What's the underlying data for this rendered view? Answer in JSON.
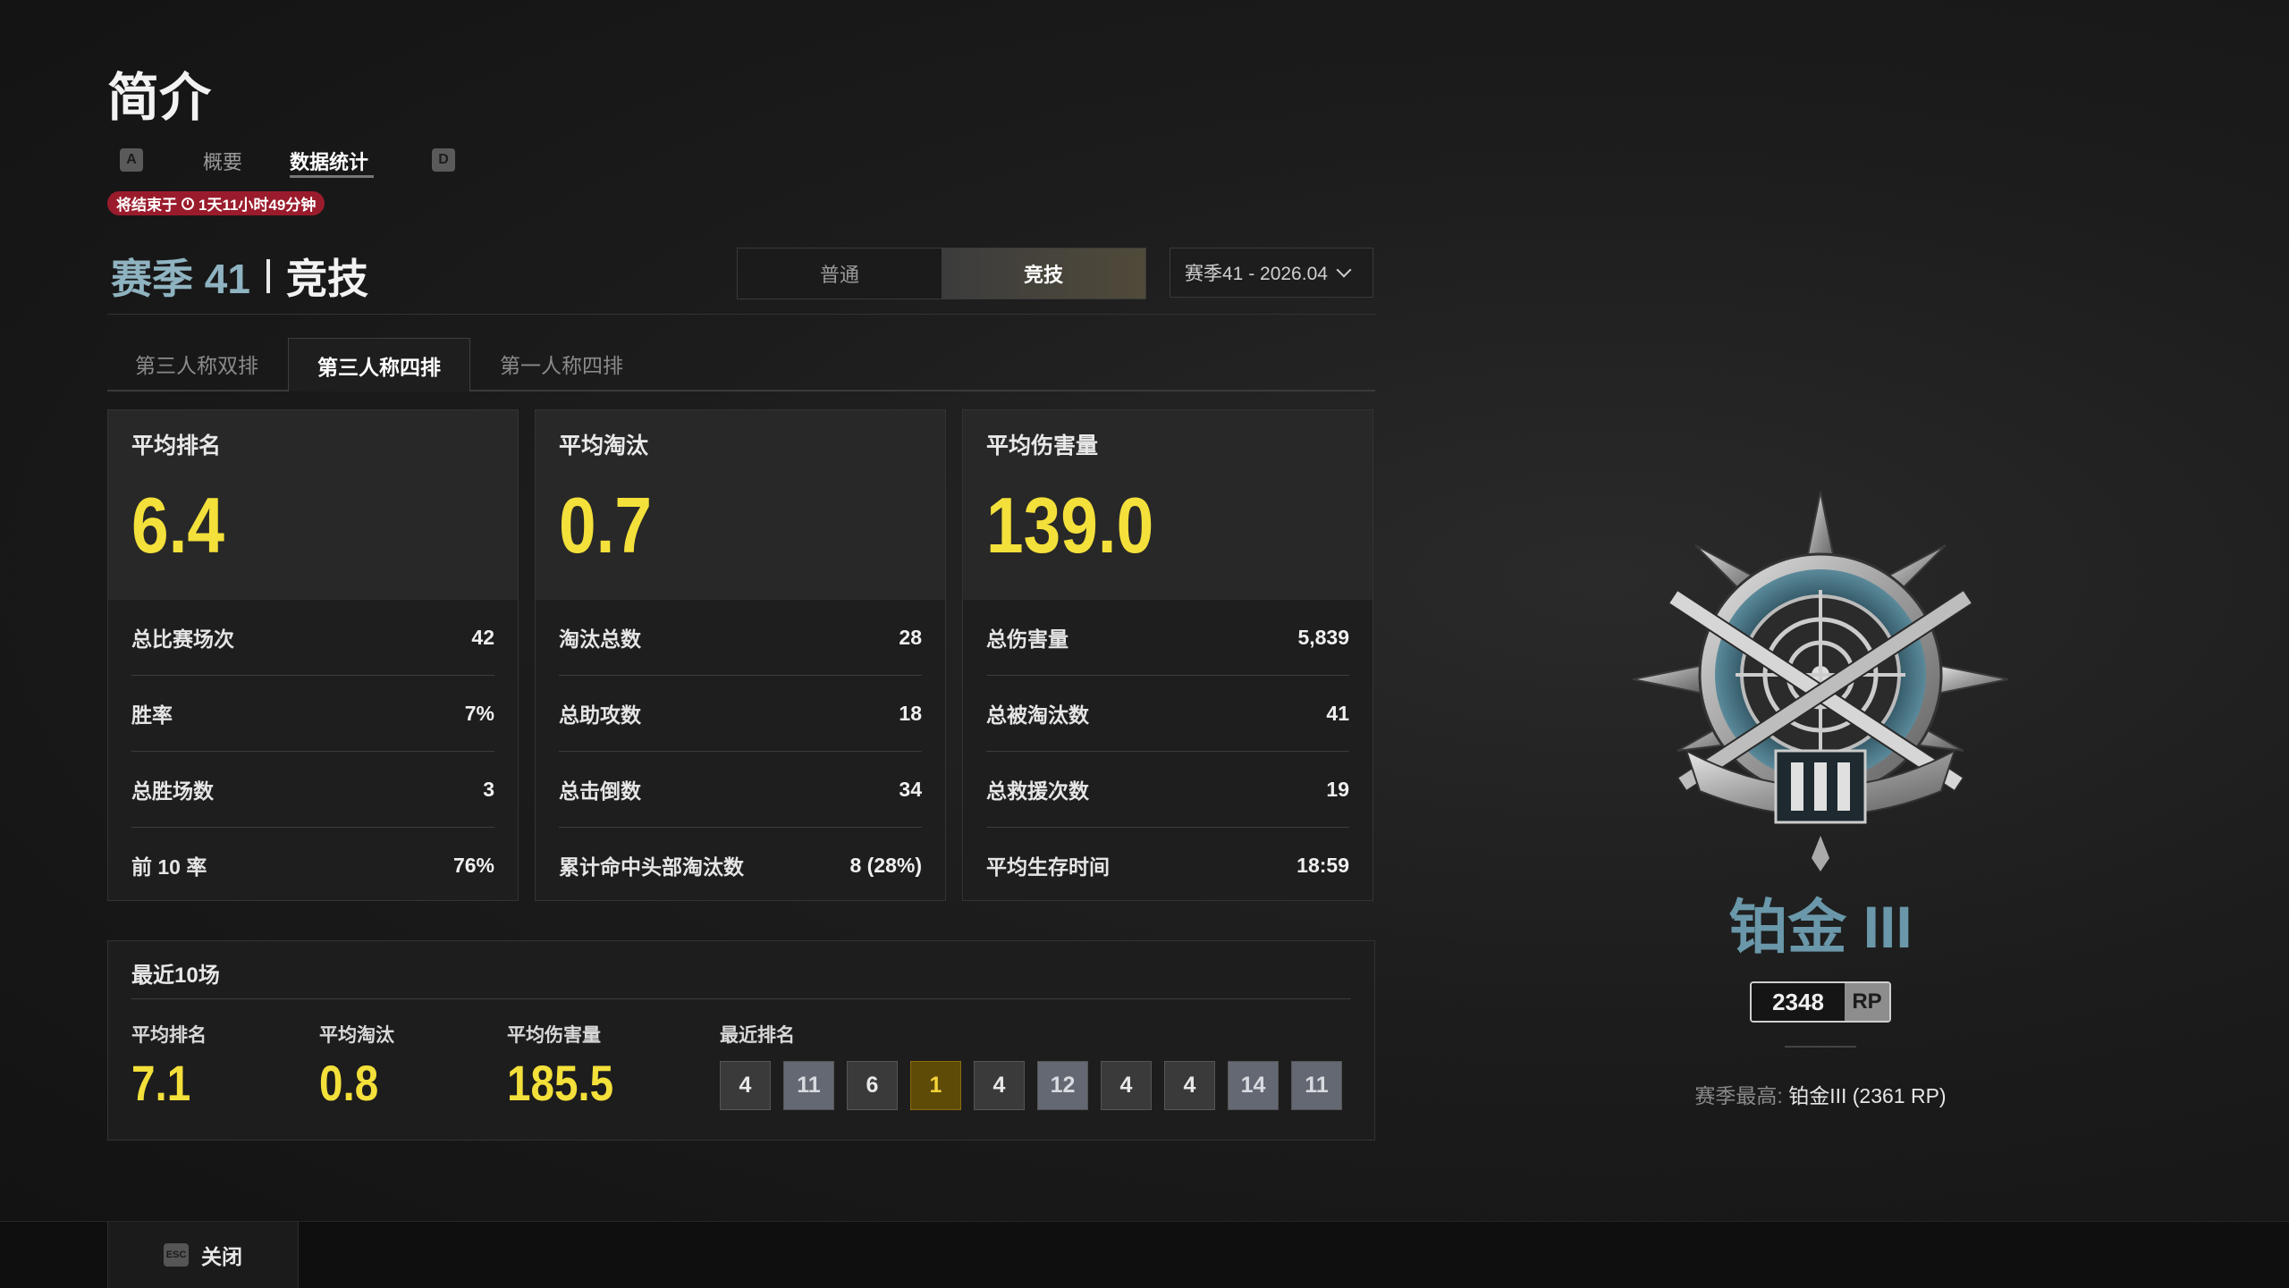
{
  "page": {
    "title": "简介"
  },
  "nav": {
    "left_key": "A",
    "right_key": "D",
    "tabs": [
      {
        "label": "概要"
      },
      {
        "label": "数据统计"
      }
    ],
    "active_tab": "数据统计"
  },
  "timer": {
    "prefix": "将结束于",
    "remaining": "1天11小时49分钟"
  },
  "season": {
    "name": "赛季 41",
    "mode": "竞技"
  },
  "mode_switch": {
    "options": [
      "普通",
      "竞技"
    ],
    "active": "竞技"
  },
  "season_select": {
    "value": "赛季41 - 2026.04"
  },
  "sub_tabs": {
    "items": [
      "第三人称双排",
      "第三人称四排",
      "第一人称四排"
    ],
    "active": "第三人称四排"
  },
  "cards": [
    {
      "label": "平均排名",
      "value": "6.4",
      "rows": [
        {
          "label": "总比赛场次",
          "value": "42"
        },
        {
          "label": "胜率",
          "value": "7%"
        },
        {
          "label": "总胜场数",
          "value": "3"
        },
        {
          "label": "前 10 率",
          "value": "76%"
        }
      ]
    },
    {
      "label": "平均淘汰",
      "value": "0.7",
      "rows": [
        {
          "label": "淘汰总数",
          "value": "28"
        },
        {
          "label": "总助攻数",
          "value": "18"
        },
        {
          "label": "总击倒数",
          "value": "34"
        },
        {
          "label": "累计命中头部淘汰数",
          "value": "8 (28%)"
        }
      ]
    },
    {
      "label": "平均伤害量",
      "value": "139.0",
      "rows": [
        {
          "label": "总伤害量",
          "value": "5,839"
        },
        {
          "label": "总被淘汰数",
          "value": "41"
        },
        {
          "label": "总救援次数",
          "value": "19"
        },
        {
          "label": "平均生存时间",
          "value": "18:59"
        }
      ]
    }
  ],
  "recent": {
    "title": "最近10场",
    "avg_rank_label": "平均排名",
    "avg_rank": "7.1",
    "avg_kills_label": "平均淘汰",
    "avg_kills": "0.8",
    "avg_damage_label": "平均伤害量",
    "avg_damage": "185.5",
    "ranks_label": "最近排名",
    "ranks": [
      {
        "value": "4",
        "style": "dark"
      },
      {
        "value": "11",
        "style": "light"
      },
      {
        "value": "6",
        "style": "dark"
      },
      {
        "value": "1",
        "style": "gold"
      },
      {
        "value": "4",
        "style": "dark"
      },
      {
        "value": "12",
        "style": "light"
      },
      {
        "value": "4",
        "style": "dark"
      },
      {
        "value": "4",
        "style": "dark"
      },
      {
        "value": "14",
        "style": "light"
      },
      {
        "value": "11",
        "style": "light"
      }
    ]
  },
  "rank_panel": {
    "emblem_icon": "platinum-rank-emblem-icon",
    "tier": "铂金 III",
    "tier_color": "#6a98aa",
    "rp_value": "2348",
    "rp_unit": "RP",
    "best_label": "赛季最高: ",
    "best_value": "铂金III (2361 RP)"
  },
  "footer": {
    "close_key": "ESC",
    "close_label": "关闭"
  },
  "colors": {
    "highlight_yellow": "#f4e03a",
    "timer_red": "#9a1c2c",
    "season_blue": "#8fb3c0"
  }
}
